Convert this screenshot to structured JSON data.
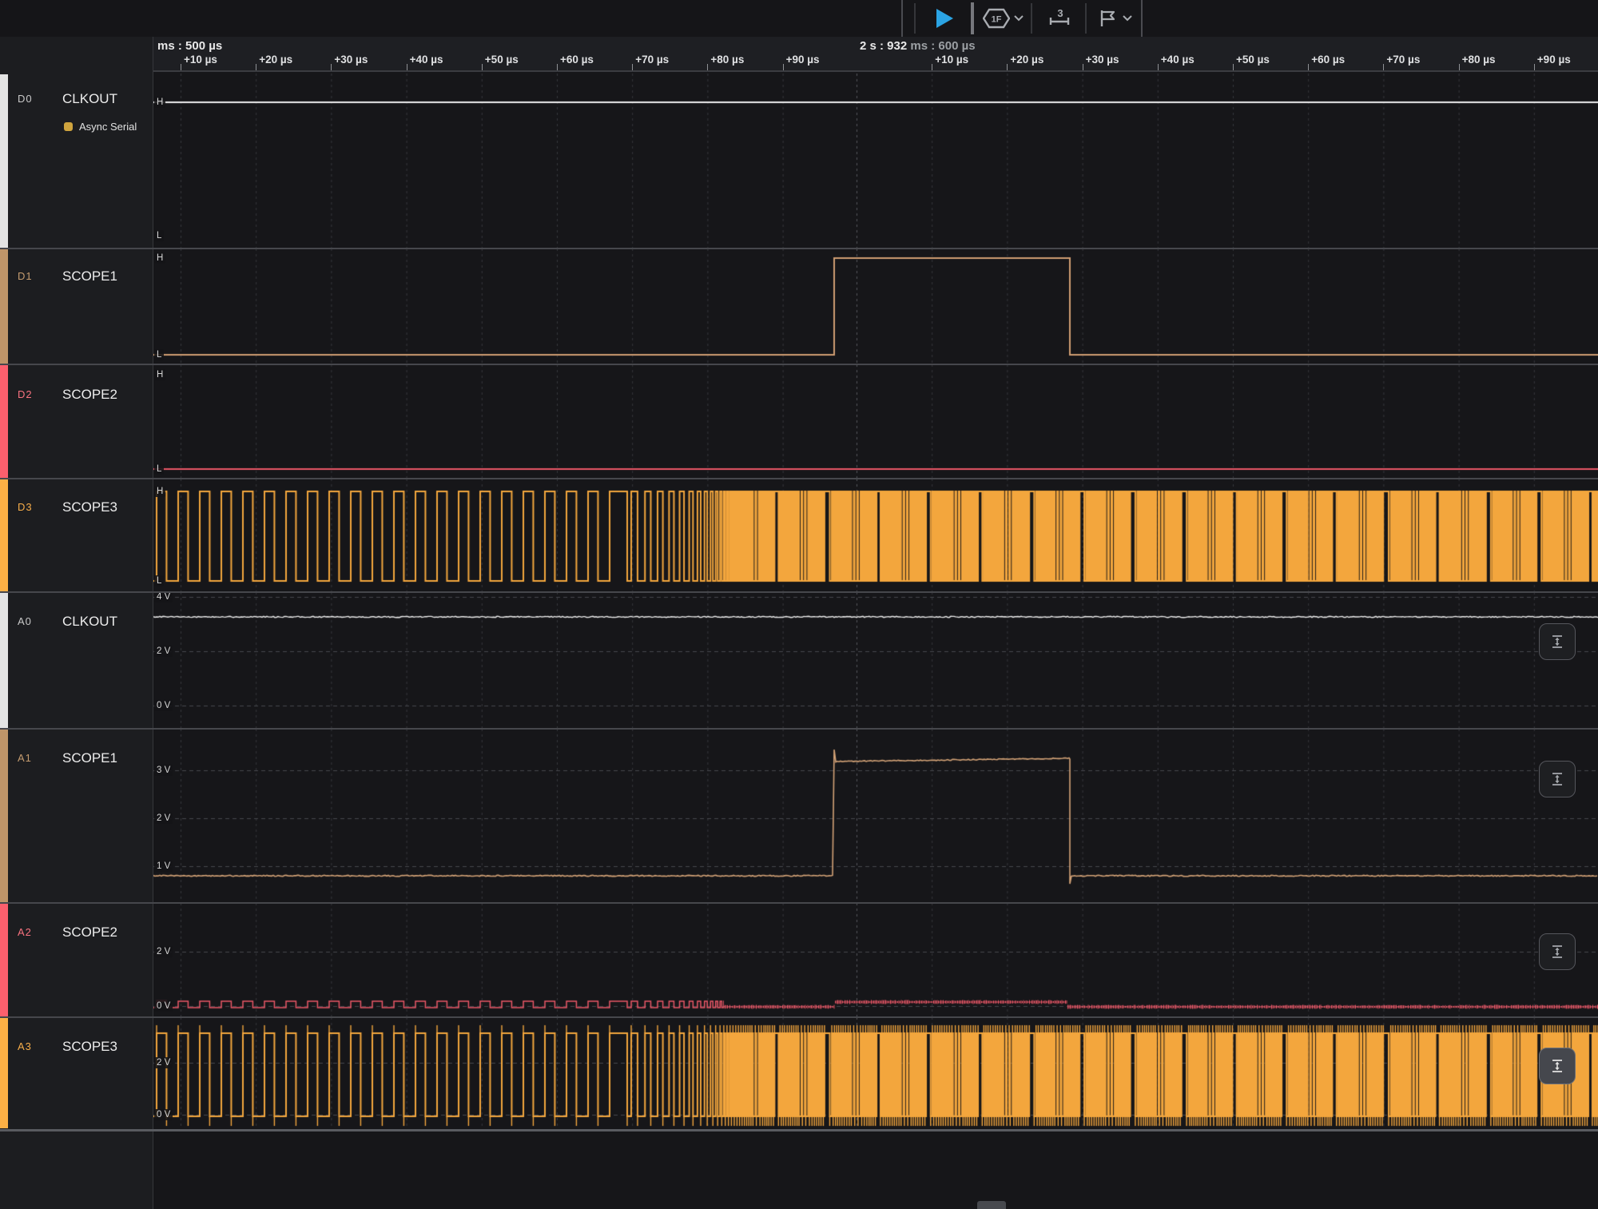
{
  "toolbar": {
    "run_tooltip": "Run",
    "trigger_badge": "1F",
    "measure_badge": "3",
    "accent_play_color": "#2ba4e4"
  },
  "ruler": {
    "left_primary": "ms : 500 µs",
    "right_primary_strong": "2 s : 932",
    "right_primary_dim": " ms : 600 µs",
    "left_ticks": [
      "+10 µs",
      "+20 µs",
      "+30 µs",
      "+40 µs",
      "+50 µs",
      "+60 µs",
      "+70 µs",
      "+80 µs",
      "+90 µs"
    ],
    "right_ticks": [
      "+10 µs",
      "+20 µs",
      "+30 µs",
      "+40 µs",
      "+50 µs",
      "+60 µs",
      "+70 µs",
      "+80 µs",
      "+90 µs"
    ]
  },
  "channels": [
    {
      "id": "D0",
      "name": "CLKOUT",
      "type": "digital",
      "strip_color": "#e3e3e3",
      "index_color": "#c9c9c9",
      "trace_color": "#eeeeee",
      "levels": {
        "high": "H",
        "low": "L"
      },
      "analyzer": {
        "label": "Async Serial",
        "swatch_color": "#cfa43e"
      },
      "signal": {
        "kind": "constant",
        "level": "high"
      }
    },
    {
      "id": "D1",
      "name": "SCOPE1",
      "type": "digital",
      "strip_color": "#bf9569",
      "index_color": "#c59c6f",
      "trace_color": "#cf9d72",
      "levels": {
        "high": "H",
        "low": "L"
      },
      "signal": {
        "kind": "pulse",
        "rest_level": "low",
        "high_start": "~597 µs",
        "high_end": "~628 µs"
      }
    },
    {
      "id": "D2",
      "name": "SCOPE2",
      "type": "digital",
      "strip_color": "#fc5f6d",
      "index_color": "#f8727f",
      "trace_color": "#ea5767",
      "levels": {
        "high": "H",
        "low": "L"
      },
      "signal": {
        "kind": "constant",
        "level": "low"
      }
    },
    {
      "id": "D3",
      "name": "SCOPE3",
      "type": "digital",
      "strip_color": "#fcb045",
      "index_color": "#f7ad49",
      "trace_color": "#f3a63d",
      "levels": {
        "high": "H",
        "low": "L"
      },
      "signal": {
        "kind": "square-chirp",
        "freq_start_hz": 350000,
        "freq_end_hz": 4000000
      }
    },
    {
      "id": "A0",
      "name": "CLKOUT",
      "type": "analog",
      "strip_color": "#e3e3e3",
      "index_color": "#c9c9c9",
      "trace_color": "#ededed",
      "grid_labels": [
        "4 V",
        "2 V",
        "0 V"
      ],
      "signal": {
        "kind": "flat",
        "volts": 3.3
      }
    },
    {
      "id": "A1",
      "name": "SCOPE1",
      "type": "analog",
      "strip_color": "#bf9569",
      "index_color": "#c59c6f",
      "trace_color": "#d4a377",
      "grid_labels": [
        "3 V",
        "2 V",
        "1 V"
      ],
      "signal": {
        "kind": "pulse",
        "base_v": 0.8,
        "high_v": 3.3,
        "high_start": "~597 µs",
        "high_end": "~628 µs"
      }
    },
    {
      "id": "A2",
      "name": "SCOPE2",
      "type": "analog",
      "strip_color": "#fc5f6d",
      "index_color": "#f8727f",
      "trace_color": "#ea5767",
      "grid_labels": [
        "2 V",
        "0 V"
      ],
      "signal": {
        "kind": "square-chirp",
        "base_v": 0,
        "high_v": 0.25
      }
    },
    {
      "id": "A3",
      "name": "SCOPE3",
      "type": "analog",
      "strip_color": "#fcb045",
      "index_color": "#f7ad49",
      "trace_color": "#f3a63d",
      "grid_labels": [
        "2 V",
        "0 V"
      ],
      "signal": {
        "kind": "square-chirp",
        "base_v": 0,
        "high_v": 3.2
      }
    }
  ]
}
